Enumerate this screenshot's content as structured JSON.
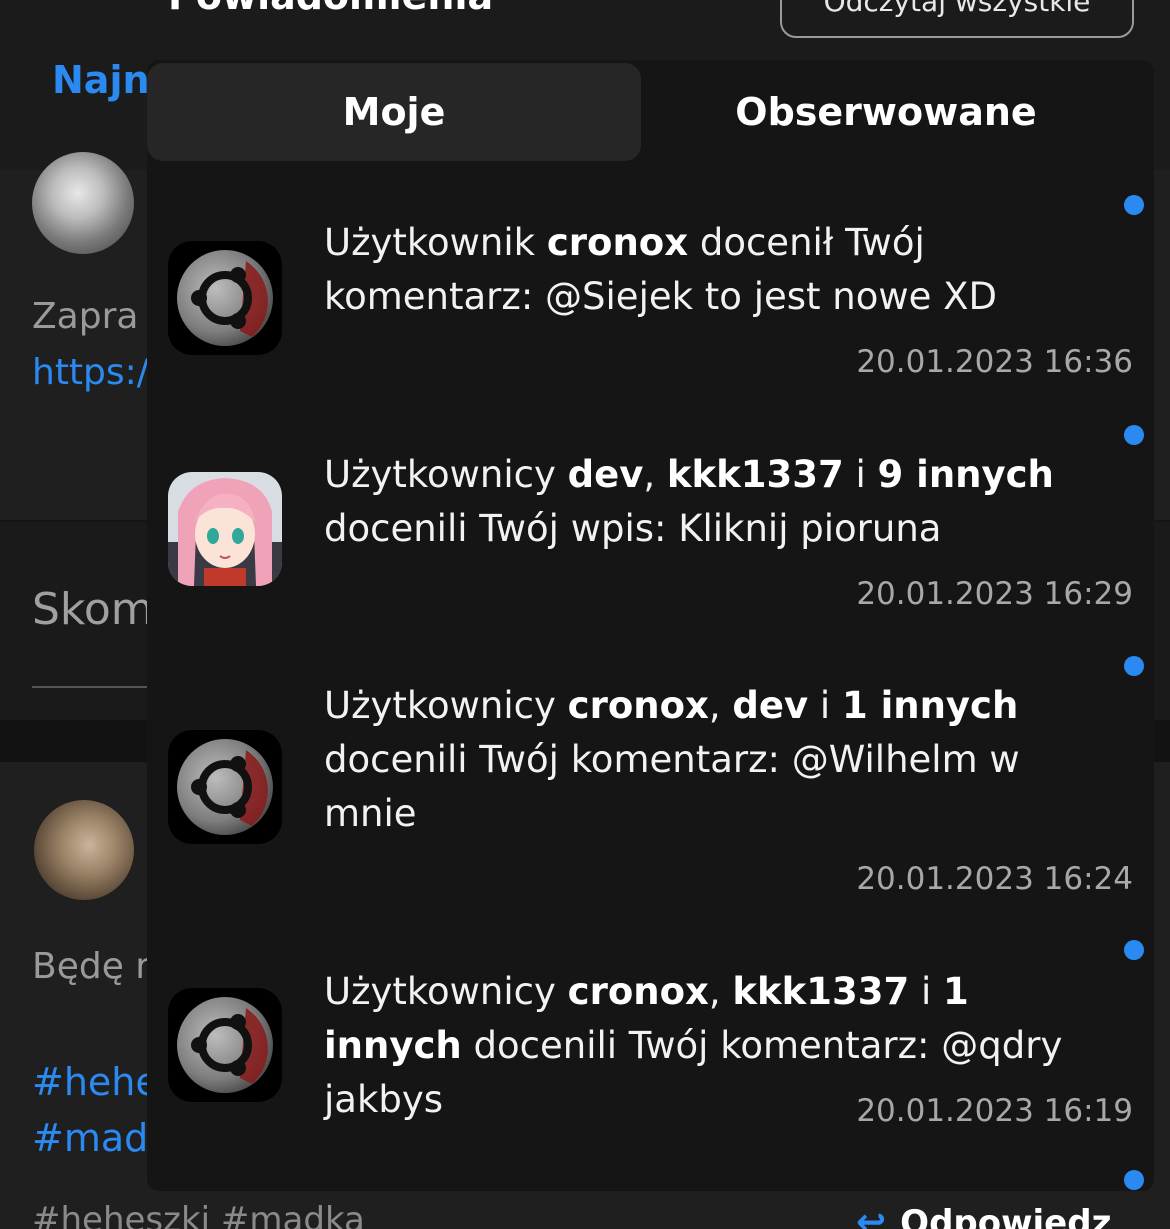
{
  "background": {
    "tab_label": "Najn",
    "post1_text": "Zapra",
    "post1_link": "https:/",
    "comment_label": "Skom",
    "post2_text": "Będę r",
    "post2_tag1": "#hehe",
    "post2_tag2": "#mad",
    "post2_tags_bottom": "#heheszki  #madka",
    "reply_label": "Odpowiedz"
  },
  "panel": {
    "title": "Powiadomienia",
    "mark_all_label": "Odczytaj wszystkie",
    "tabs": [
      {
        "label": "Moje",
        "active": true
      },
      {
        "label": "Obserwowane",
        "active": false
      }
    ]
  },
  "notifications": [
    {
      "avatar": "ubuntu-logo",
      "prefix": "Użytkownik ",
      "users": [
        "cronox"
      ],
      "sep1": "",
      "joiner": "",
      "others": "",
      "action": " docenił Twój komentarz: @Siejek to jest nowe XD",
      "time": "20.01.2023 16:36",
      "unread": true
    },
    {
      "avatar": "anime-girl",
      "prefix": "Użytkownicy ",
      "users": [
        "dev",
        "kkk1337"
      ],
      "sep1": ", ",
      "joiner": " i ",
      "others": "9 innych",
      "action": " docenili Twój wpis: Kliknij pioruna",
      "time": "20.01.2023 16:29",
      "unread": true
    },
    {
      "avatar": "ubuntu-logo",
      "prefix": "Użytkownicy ",
      "users": [
        "cronox",
        "dev"
      ],
      "sep1": ", ",
      "joiner": " i ",
      "others": "1 innych",
      "action": " docenili Twój komentarz: @Wilhelm w mnie",
      "time": "20.01.2023 16:24",
      "unread": true
    },
    {
      "avatar": "ubuntu-logo",
      "prefix": "Użytkownicy ",
      "users": [
        "cronox",
        "kkk1337"
      ],
      "sep1": ", ",
      "joiner": " i ",
      "others": "1 innych",
      "action": " docenili Twój komentarz: @qdry jakbys",
      "time": "20.01.2023 16:19",
      "unread": true
    }
  ],
  "colors": {
    "accent": "#2a8af2",
    "panel_bg": "#151515",
    "tab_active_bg": "#262626"
  }
}
